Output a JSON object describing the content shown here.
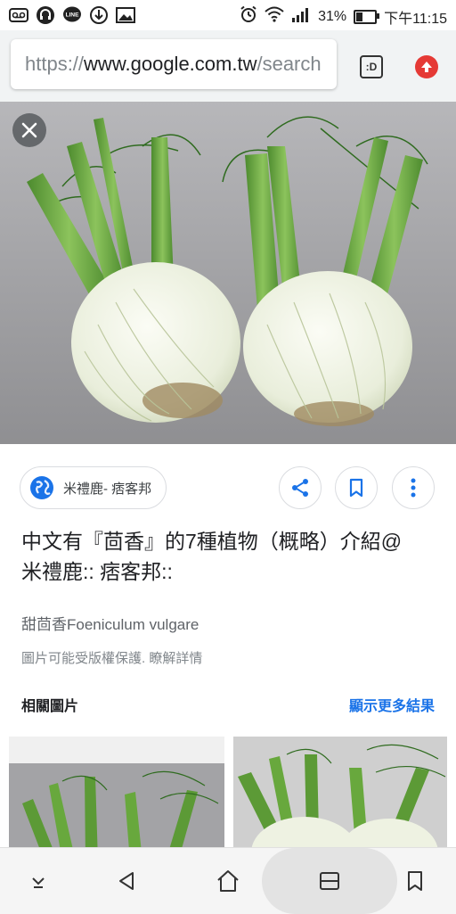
{
  "status_bar": {
    "battery": "31%",
    "time": "下午11:15",
    "icons_left": [
      "voicemail-icon",
      "headset-icon",
      "line-icon",
      "download-icon",
      "image-icon"
    ],
    "icons_right": [
      "alarm-icon",
      "wifi-icon",
      "signal-icon",
      "battery-icon"
    ],
    "line_label": "LINE",
    "battery_level": 0.31
  },
  "browser": {
    "url_scheme": "https://",
    "url_host": "www.google.com.tw",
    "url_tail": "/search",
    "tab_count_label": ":D",
    "accent": "#e53935"
  },
  "image_viewer": {
    "source_name": "米禮鹿- 痞客邦",
    "title": "中文有『茴香』的7種植物（概略）介紹@ 米禮鹿:: 痞客邦::",
    "subtitle": "甜茴香Foeniculum vulgare",
    "copyright_notice": "圖片可能受版權保護. 瞭解詳情",
    "related_label": "相關圖片",
    "more_results_label": "顯示更多結果",
    "link_color": "#1a73e8"
  },
  "bottom_nav": {
    "items": [
      "chevron-down-icon",
      "back-icon",
      "home-icon",
      "tabs-icon",
      "bookmark-icon"
    ]
  }
}
